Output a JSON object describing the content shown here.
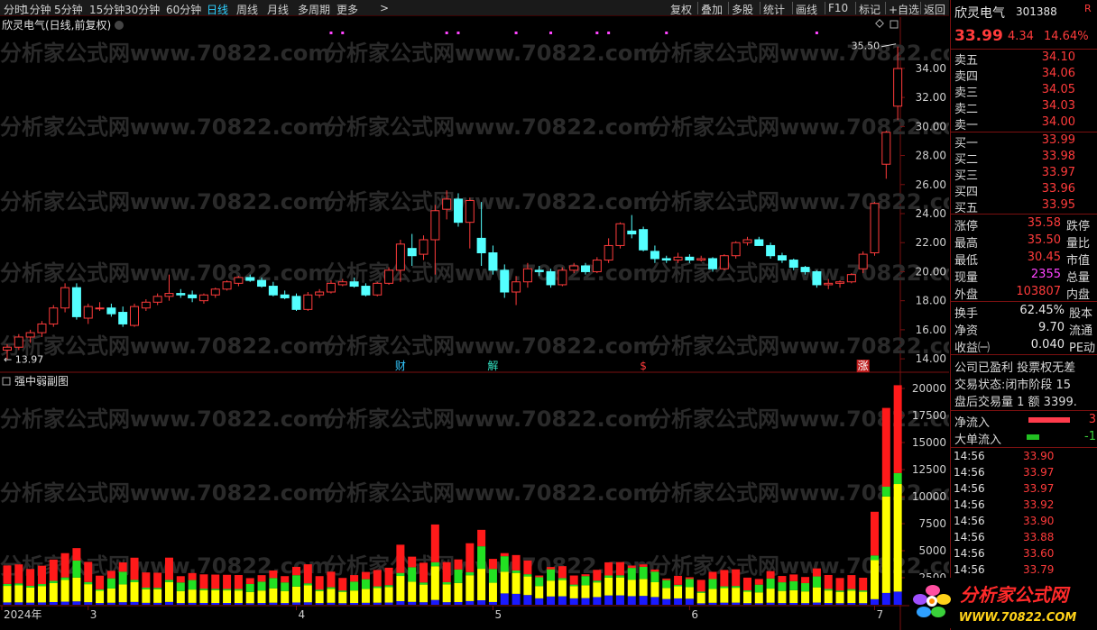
{
  "toolbar": {
    "timeframes": [
      "分时",
      "1分钟",
      "5分钟",
      "15分钟",
      "30分钟",
      "60分钟",
      "日线",
      "周线",
      "月线",
      "多周期",
      "更多"
    ],
    "active_timeframe": "日线",
    "right_buttons": [
      "复权",
      "叠加",
      "多股",
      "统计",
      "画线",
      "F10",
      "标记",
      "+自选",
      "返回"
    ]
  },
  "chart_header": {
    "title": "欣灵电气(日线,前复权)",
    "high_label": "35.50",
    "low_label": "13.97"
  },
  "sub_header": {
    "title": "强中弱副图"
  },
  "markers": [
    {
      "index": 34,
      "text": "财",
      "color": "#33c8ff"
    },
    {
      "index": 42,
      "text": "解",
      "color": "#33e0c0"
    },
    {
      "index": 55,
      "text": "$",
      "color": "#ff3b3b"
    },
    {
      "index": 74,
      "text": "涨",
      "color": "#ffffff",
      "bg": "#c02020"
    }
  ],
  "watermark": "分析家公式网www.70822.com",
  "chart_data": [
    {
      "type": "candlestick",
      "price_axis": {
        "ticks": [
          14.0,
          16.0,
          18.0,
          20.0,
          22.0,
          24.0,
          26.0,
          28.0,
          30.0,
          32.0,
          34.0
        ],
        "ylim": [
          13.2,
          36.6
        ]
      },
      "x_axis": {
        "labels": [
          {
            "index": 0,
            "text": "2024年"
          },
          {
            "index": 7,
            "text": "3"
          },
          {
            "index": 25,
            "text": "4"
          },
          {
            "index": 42,
            "text": "5"
          },
          {
            "index": 59,
            "text": "6"
          },
          {
            "index": 75,
            "text": "7"
          }
        ]
      },
      "up_color": "#ff3b3b",
      "down_color": "#54ffff",
      "candles": [
        [
          14.6,
          15.0,
          13.97,
          14.8
        ],
        [
          14.8,
          15.7,
          14.6,
          15.5
        ],
        [
          15.5,
          16.0,
          15.1,
          15.8
        ],
        [
          15.8,
          16.6,
          15.5,
          16.4
        ],
        [
          16.4,
          17.7,
          16.2,
          17.5
        ],
        [
          17.5,
          19.2,
          17.2,
          18.9
        ],
        [
          18.9,
          19.2,
          16.7,
          16.9
        ],
        [
          16.8,
          17.8,
          16.4,
          17.6
        ],
        [
          17.5,
          17.9,
          17.3,
          17.5
        ],
        [
          17.5,
          17.8,
          16.9,
          17.1
        ],
        [
          17.2,
          17.6,
          16.2,
          16.4
        ],
        [
          16.3,
          17.8,
          16.2,
          17.6
        ],
        [
          17.5,
          18.1,
          17.3,
          17.9
        ],
        [
          17.9,
          18.5,
          17.7,
          18.3
        ],
        [
          18.3,
          19.8,
          18.0,
          18.5
        ],
        [
          18.5,
          18.8,
          18.2,
          18.4
        ],
        [
          18.4,
          18.7,
          17.9,
          18.2
        ],
        [
          18.0,
          18.5,
          17.8,
          18.4
        ],
        [
          18.4,
          18.9,
          18.2,
          18.8
        ],
        [
          18.8,
          19.4,
          18.7,
          19.3
        ],
        [
          19.2,
          19.7,
          19.0,
          19.6
        ],
        [
          19.6,
          19.8,
          19.3,
          19.4
        ],
        [
          19.4,
          19.6,
          18.9,
          19.0
        ],
        [
          19.0,
          19.3,
          18.3,
          18.4
        ],
        [
          18.4,
          18.7,
          18.1,
          18.2
        ],
        [
          18.3,
          18.5,
          17.3,
          17.4
        ],
        [
          17.4,
          18.6,
          17.3,
          18.4
        ],
        [
          18.4,
          18.8,
          18.2,
          18.6
        ],
        [
          18.6,
          19.4,
          18.5,
          19.2
        ],
        [
          19.1,
          19.5,
          19.0,
          19.3
        ],
        [
          19.3,
          19.6,
          18.9,
          19.0
        ],
        [
          19.0,
          19.2,
          18.3,
          18.4
        ],
        [
          18.4,
          19.3,
          18.3,
          19.2
        ],
        [
          19.2,
          20.3,
          19.1,
          20.1
        ],
        [
          20.1,
          22.2,
          19.3,
          21.9
        ],
        [
          21.6,
          22.6,
          20.4,
          21.1
        ],
        [
          21.2,
          22.5,
          20.8,
          22.2
        ],
        [
          22.2,
          24.6,
          19.8,
          24.2
        ],
        [
          24.3,
          25.6,
          23.6,
          25.0
        ],
        [
          25.0,
          25.4,
          23.1,
          23.4
        ],
        [
          23.4,
          25.1,
          21.6,
          24.9
        ],
        [
          22.3,
          24.8,
          20.4,
          21.3
        ],
        [
          21.3,
          21.8,
          19.8,
          20.1
        ],
        [
          20.1,
          20.5,
          18.2,
          18.6
        ],
        [
          18.6,
          19.7,
          17.7,
          19.3
        ],
        [
          19.3,
          20.6,
          18.9,
          20.2
        ],
        [
          20.1,
          20.4,
          19.7,
          20.0
        ],
        [
          20.0,
          20.2,
          18.9,
          19.1
        ],
        [
          19.1,
          20.3,
          19.0,
          20.1
        ],
        [
          20.1,
          20.6,
          19.9,
          20.4
        ],
        [
          20.4,
          20.6,
          19.8,
          20.0
        ],
        [
          20.0,
          21.0,
          19.9,
          20.8
        ],
        [
          20.8,
          22.3,
          20.6,
          21.8
        ],
        [
          21.8,
          23.4,
          21.6,
          23.3
        ],
        [
          22.8,
          23.9,
          22.3,
          22.6
        ],
        [
          22.9,
          23.1,
          21.4,
          21.5
        ],
        [
          21.4,
          21.8,
          20.6,
          20.9
        ],
        [
          20.9,
          21.1,
          20.6,
          20.8
        ],
        [
          20.8,
          21.3,
          20.6,
          21.0
        ],
        [
          21.0,
          21.2,
          20.6,
          20.8
        ],
        [
          20.8,
          21.1,
          20.7,
          20.9
        ],
        [
          20.9,
          21.0,
          20.0,
          20.2
        ],
        [
          20.2,
          21.2,
          20.1,
          21.1
        ],
        [
          21.1,
          22.1,
          20.9,
          22.0
        ],
        [
          22.0,
          22.4,
          21.8,
          22.2
        ],
        [
          22.2,
          22.4,
          21.9,
          21.8
        ],
        [
          21.8,
          22.0,
          20.9,
          21.1
        ],
        [
          21.1,
          21.3,
          20.6,
          20.8
        ],
        [
          20.8,
          20.9,
          20.1,
          20.3
        ],
        [
          20.3,
          20.4,
          19.8,
          20.0
        ],
        [
          20.0,
          20.1,
          18.9,
          19.1
        ],
        [
          19.1,
          19.5,
          18.8,
          19.2
        ],
        [
          19.2,
          19.4,
          18.9,
          19.3
        ],
        [
          19.3,
          19.9,
          19.2,
          19.8
        ]
      ]
    },
    {
      "type": "bar",
      "stacked": true,
      "y_axis": {
        "ticks": [
          2500,
          5000,
          7500,
          10000,
          12500,
          15000,
          17500,
          20000
        ],
        "ylim": [
          0,
          21000
        ]
      },
      "series": [
        {
          "color": "#ff1a1a",
          "values": []
        },
        {
          "color": "#22e022",
          "values": []
        },
        {
          "color": "#ffff00",
          "values": []
        },
        {
          "color": "#1a1aff",
          "values": []
        }
      ]
    }
  ],
  "quote": {
    "name": "欣灵电气",
    "code": "301388",
    "tag": "R",
    "price": "33.99",
    "change": "4.34",
    "change_pct": "14.64%",
    "asks": [
      {
        "label": "卖五",
        "price": "34.10"
      },
      {
        "label": "卖四",
        "price": "34.06"
      },
      {
        "label": "卖三",
        "price": "34.05"
      },
      {
        "label": "卖二",
        "price": "34.03"
      },
      {
        "label": "卖一",
        "price": "34.00"
      }
    ],
    "bids": [
      {
        "label": "买一",
        "price": "33.99"
      },
      {
        "label": "买二",
        "price": "33.98"
      },
      {
        "label": "买三",
        "price": "33.97"
      },
      {
        "label": "买四",
        "price": "33.96"
      },
      {
        "label": "买五",
        "price": "33.95"
      }
    ],
    "stats": [
      {
        "label": "涨停",
        "value": "35.58",
        "color": "red",
        "label2": "跌停"
      },
      {
        "label": "最高",
        "value": "35.50",
        "color": "red",
        "label2": "量比"
      },
      {
        "label": "最低",
        "value": "30.45",
        "color": "red",
        "label2": "市值"
      },
      {
        "label": "现量",
        "value": "2355",
        "color": "mag",
        "label2": "总量"
      },
      {
        "label": "外盘",
        "value": "103807",
        "color": "red",
        "label2": "内盘"
      }
    ],
    "stats2": [
      {
        "label": "换手",
        "value": "62.45%",
        "label2": "股本"
      },
      {
        "label": "净资",
        "value": "9.70",
        "label2": "流通"
      },
      {
        "label": "收益㈠",
        "value": "0.040",
        "label2": "PE动"
      }
    ],
    "notes": [
      "公司已盈利 投票权无差",
      "交易状态:闭市阶段 15",
      "盘后交易量 1 额 3399."
    ],
    "flows": [
      {
        "label": "净流入",
        "color": "#ff3b4b",
        "value": "3"
      },
      {
        "label": "大单流入",
        "color": "#22c022",
        "value": "-1"
      }
    ],
    "ticks": [
      {
        "time": "14:56",
        "price": "33.90"
      },
      {
        "time": "14:56",
        "price": "33.97"
      },
      {
        "time": "14:56",
        "price": "33.97"
      },
      {
        "time": "14:56",
        "price": "33.92"
      },
      {
        "time": "14:56",
        "price": "33.90"
      },
      {
        "time": "14:56",
        "price": "33.88"
      },
      {
        "time": "14:56",
        "price": "33.60"
      },
      {
        "time": "14:56",
        "price": "33.79"
      }
    ]
  },
  "logo": {
    "text": "分析家公式网",
    "url": "WWW.70822.COM"
  }
}
